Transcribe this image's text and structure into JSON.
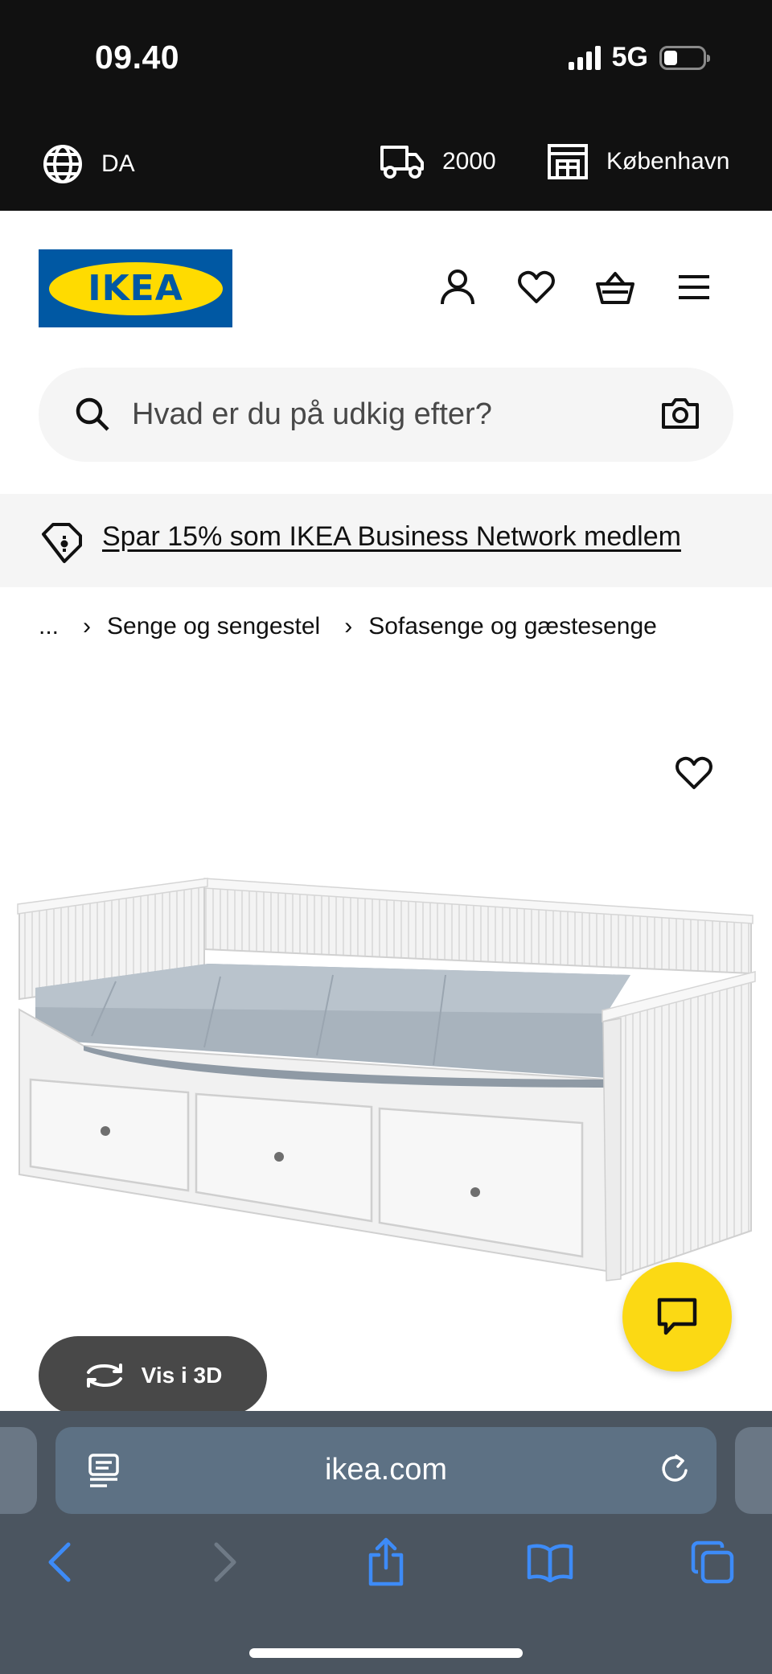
{
  "status_bar": {
    "time": "09.40",
    "network": "5G"
  },
  "locale_bar": {
    "language": "DA",
    "postcode": "2000",
    "store": "København"
  },
  "header": {
    "logo_text": "IKEA",
    "icons": [
      "user-icon",
      "heart-icon",
      "basket-icon",
      "menu-icon"
    ]
  },
  "search": {
    "placeholder": "Hvad er du på udkig efter?"
  },
  "promo": {
    "text": "Spar 15% som IKEA Business Network medlem"
  },
  "breadcrumb": {
    "ellipsis": "...",
    "items": [
      "Senge og sengestel",
      "Sofasenge og gæstesenge"
    ]
  },
  "product": {
    "view_3d_label": "Vis i 3D"
  },
  "browser": {
    "url": "ikea.com"
  },
  "colors": {
    "ikea_blue": "#0058a3",
    "ikea_yellow": "#ffdb00",
    "chat_yellow": "#fbd914",
    "ios_blue": "#3d8bf7"
  }
}
